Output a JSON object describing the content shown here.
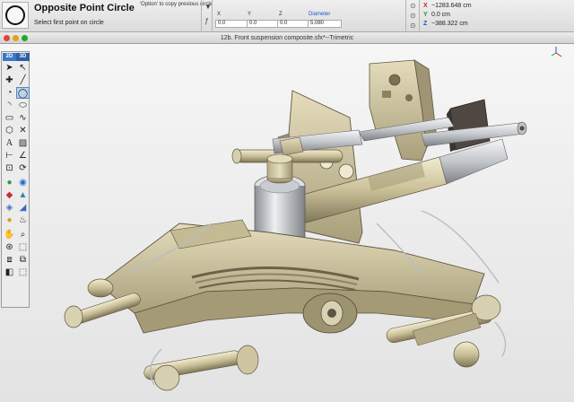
{
  "tool": {
    "title": "Opposite Point Circle",
    "hint": "'Option' to copy previous circle",
    "prompt": "Select first point on circle",
    "icon": "circle-tool-icon"
  },
  "fields": {
    "x_label": "X",
    "y_label": "Y",
    "z_label": "Z",
    "diameter_label": "Diameter",
    "x_value": "0.0",
    "y_value": "0.0",
    "z_value": "0.0",
    "diameter_value": "5.080"
  },
  "coords": {
    "x_label": "X",
    "x_value": "−1283.648 cm",
    "y_label": "Y",
    "y_value": "0.0 cm",
    "z_label": "Z",
    "z_value": "−388.322 cm"
  },
  "window": {
    "title": "12b. Front suspension composite.sfx*--Trimetric"
  },
  "palette": {
    "tab_2d": "2D",
    "tab_3d": "3D",
    "tools": [
      "arrow",
      "arrow-dot",
      "point",
      "line",
      "arc",
      "circle",
      "arc-3pt",
      "ellipse",
      "rect",
      "spline",
      "polygon",
      "trim",
      "text",
      "hatch",
      "dim",
      "dim-angle",
      "move",
      "rotate",
      "sphere",
      "cone",
      "extrude",
      "revolve",
      "box",
      "light",
      "bulb",
      "hand",
      "zoom",
      "camera",
      "view-front",
      "view-iso",
      "view-side",
      "view-shade"
    ]
  },
  "colors": {
    "accent": "#2060c8",
    "chassis": "#cdc5a2",
    "chassis_dark": "#8f8666",
    "metal": "#d7d9dc",
    "steel_dark": "#6a6d70",
    "leather": "#5a514a"
  }
}
